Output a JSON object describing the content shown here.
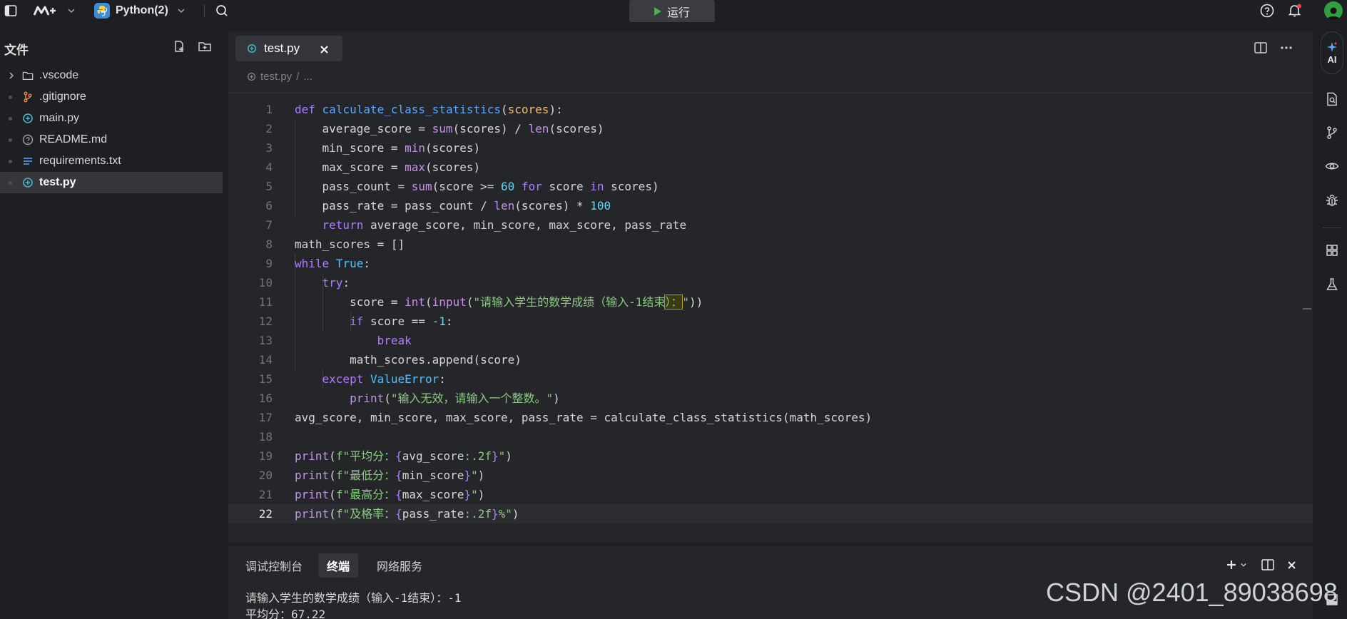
{
  "topbar": {
    "project": "Python(2)",
    "run_label": "运行"
  },
  "sidebar": {
    "title": "文件",
    "items": [
      {
        "label": ".vscode",
        "icon": "folder-icon"
      },
      {
        "label": ".gitignore",
        "icon": "git-icon"
      },
      {
        "label": "main.py",
        "icon": "python-file-icon"
      },
      {
        "label": "README.md",
        "icon": "info-icon"
      },
      {
        "label": "requirements.txt",
        "icon": "text-file-icon"
      },
      {
        "label": "test.py",
        "icon": "python-file-icon",
        "active": true
      }
    ]
  },
  "editor": {
    "tab_label": "test.py",
    "breadcrumb_file": "test.py",
    "breadcrumb_more": "...",
    "current_line": 22,
    "line_numbers": [
      "1",
      "2",
      "3",
      "4",
      "5",
      "6",
      "7",
      "8",
      "9",
      "10",
      "11",
      "12",
      "13",
      "14",
      "15",
      "16",
      "17",
      "18",
      "19",
      "20",
      "21",
      "22"
    ]
  },
  "panel": {
    "tabs": [
      "调试控制台",
      "终端",
      "网络服务"
    ],
    "active_tab": "终端",
    "terminal_lines": [
      "请输入学生的数学成绩（输入-1结束）：-1",
      "平均分：67.22"
    ]
  },
  "rail": {
    "ai_label": "AI"
  },
  "watermark": "CSDN @2401_89038698",
  "colors": {
    "background": "#1e1f22",
    "editor": "#25262a",
    "run_icon": "#3fb950",
    "accent": "#5aa7ff"
  }
}
